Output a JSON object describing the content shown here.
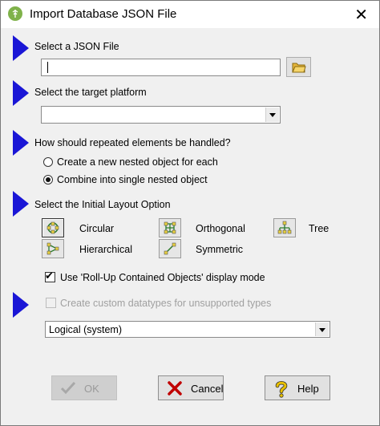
{
  "window": {
    "title": "Import Database JSON File",
    "close_glyph": "✕"
  },
  "sections": {
    "file": {
      "label": "Select a JSON File",
      "value": ""
    },
    "platform": {
      "label": "Select the target platform",
      "selected": ""
    },
    "repeated": {
      "label": "How should repeated elements be handled?",
      "options": [
        "Create a new nested object for each",
        "Combine into single nested object"
      ],
      "selected_index": 1
    },
    "layout": {
      "label": "Select the Initial Layout Option",
      "options": [
        "Circular",
        "Orthogonal",
        "Tree",
        "Hierarchical",
        "Symmetric"
      ],
      "rollup_label": "Use 'Roll-Up Contained Objects' display mode",
      "rollup_checked": true
    },
    "datatypes": {
      "label": "Create custom datatypes for unsupported types",
      "checked": false,
      "enabled": false,
      "combo_value": "Logical (system)"
    }
  },
  "buttons": {
    "ok": "OK",
    "cancel": "Cancel",
    "help": "Help"
  },
  "colors": {
    "arrow": "#1a16d6",
    "dialog_bg": "#f0f0f0",
    "titlebar_bg": "#ffffff",
    "cancel_icon": "#c00000",
    "help_icon": "#e8c000"
  }
}
